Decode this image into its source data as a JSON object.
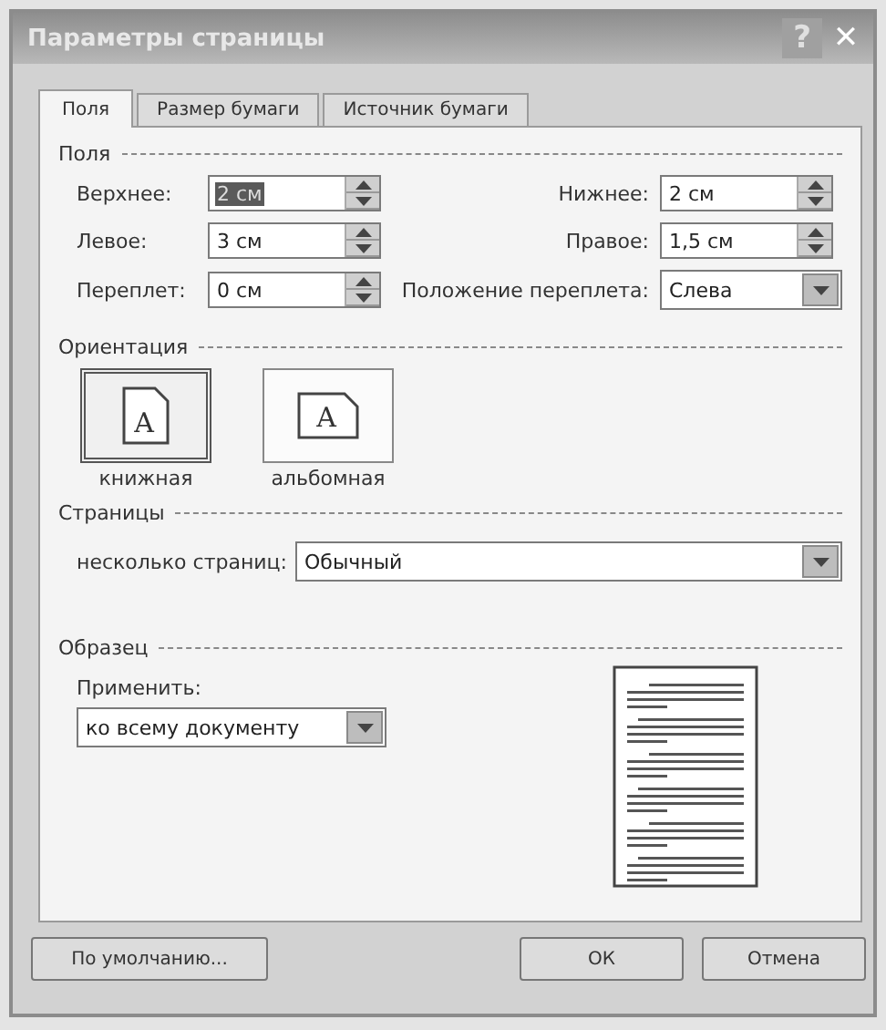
{
  "window": {
    "title": "Параметры страницы",
    "help_glyph": "?",
    "close_glyph": "✕"
  },
  "tabs": [
    {
      "label": "Поля",
      "selected": true
    },
    {
      "label": "Размер бумаги",
      "selected": false
    },
    {
      "label": "Источник бумаги",
      "selected": false
    }
  ],
  "margins": {
    "heading": "Поля",
    "fields": [
      {
        "label": "Верхнее:",
        "value": "2 см",
        "selected": true
      },
      {
        "label": "Нижнее:",
        "value": "2 см",
        "selected": false
      },
      {
        "label": "Левое:",
        "value": "3 см",
        "selected": false
      },
      {
        "label": "Правое:",
        "value": "1,5 см",
        "selected": false
      },
      {
        "label": "Переплет:",
        "value": "0 см",
        "selected": false
      }
    ],
    "gutter_position": {
      "label": "Положение переплета:",
      "value": "Слева"
    }
  },
  "orientation": {
    "heading": "Ориентация",
    "options": [
      {
        "label": "книжная",
        "glyph": "A",
        "kind": "portrait",
        "selected": true
      },
      {
        "label": "альбомная",
        "glyph": "A",
        "kind": "landscape",
        "selected": false
      }
    ]
  },
  "pages": {
    "heading": "Страницы",
    "label": "несколько страниц:",
    "value": "Обычный"
  },
  "preview": {
    "heading": "Образец",
    "apply_label": "Применить:",
    "apply_value": "ко всему документу"
  },
  "buttons": [
    {
      "label": "По умолчанию...",
      "kind": "left"
    },
    {
      "label": "ОК",
      "kind": "right"
    },
    {
      "label": "Отмена",
      "kind": "right"
    }
  ]
}
